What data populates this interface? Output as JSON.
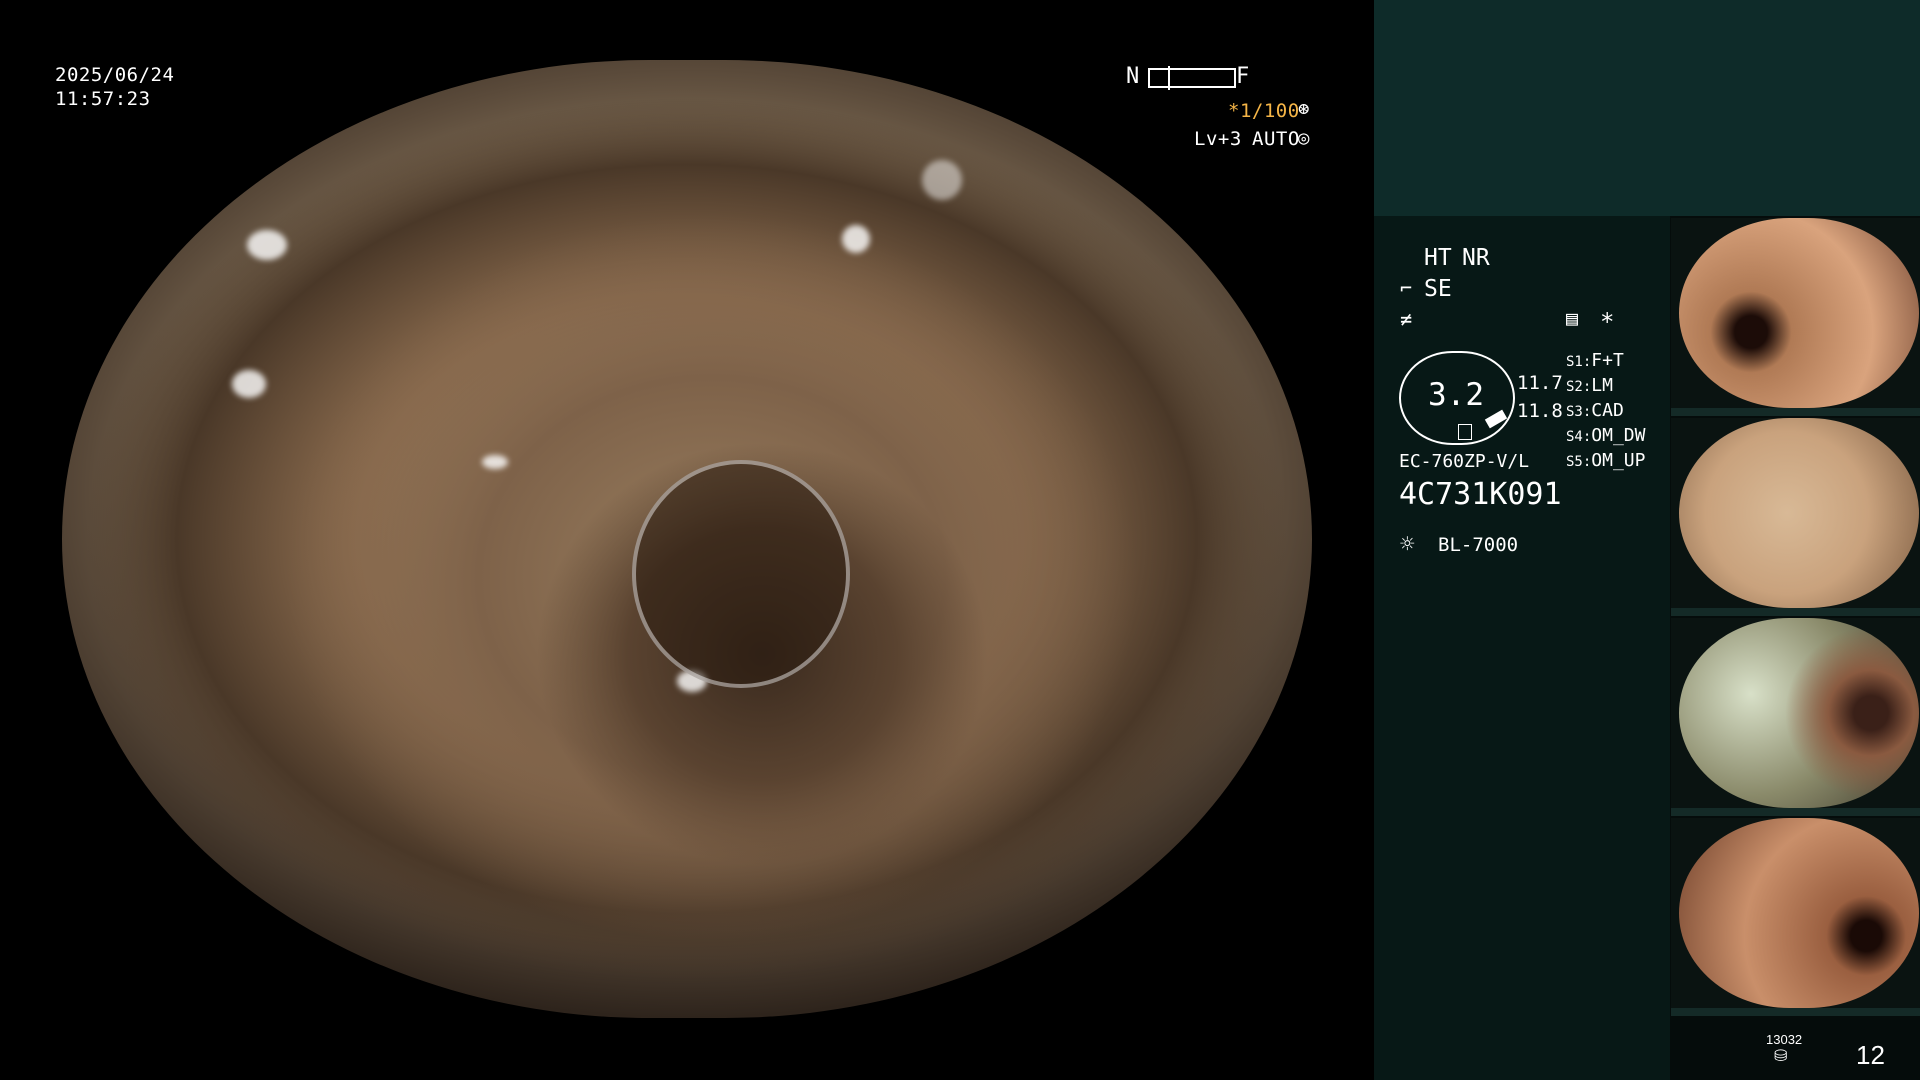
{
  "osd": {
    "date": "2025/06/24",
    "time": "11:57:23",
    "focus_near": "N",
    "focus_far": "F",
    "shutter": "*1/100",
    "level": "Lv+3",
    "exposure_mode": "AUTO"
  },
  "info": {
    "ht": "HT",
    "nr": "NR",
    "se": "SE",
    "zoom": "3.2",
    "val_top": "11.7",
    "val_bottom": "11.8",
    "scope_model": "EC-760ZP-V/L",
    "serial": "4C731K091",
    "light_source": "BL-7000",
    "asterisk": "*",
    "switches": [
      {
        "key": "S1:",
        "value": "F+T"
      },
      {
        "key": "S2:",
        "value": "LM"
      },
      {
        "key": "S3:",
        "value": "CAD"
      },
      {
        "key": "S4:",
        "value": "OM_DW"
      },
      {
        "key": "S5:",
        "value": "OM_UP"
      }
    ]
  },
  "thumbnails": [
    {
      "name": "capture-1",
      "color": "#b07a55"
    },
    {
      "name": "capture-2",
      "color": "#c9a27d"
    },
    {
      "name": "capture-3",
      "color": "#9a8a6a"
    },
    {
      "name": "capture-4",
      "color": "#b57b58"
    }
  ],
  "footer": {
    "storage_count": "13032",
    "image_count": "12"
  },
  "colors": {
    "accent": "#f5b547",
    "panel_top": "#0e2b29",
    "panel_bg": "#071816"
  }
}
